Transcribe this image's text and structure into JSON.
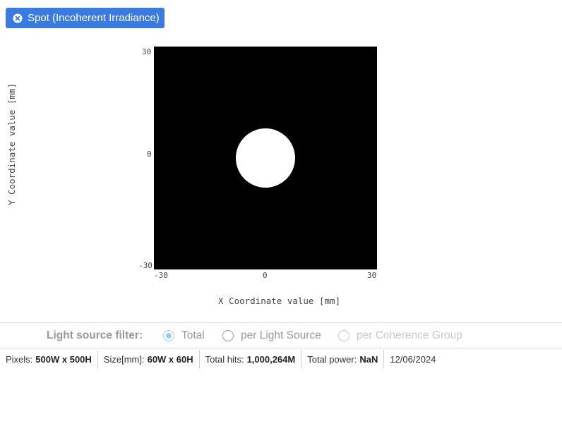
{
  "header": {
    "title": "Spot (Incoherent Irradiance)",
    "icon": "close-circle-icon",
    "accent_color": "#3a7be0"
  },
  "plot": {
    "x_axis_title": "X Coordinate value [mm]",
    "y_axis_title": "Y Coordinate value [mm]",
    "x_ticks": [
      "-30",
      "0",
      "30"
    ],
    "y_ticks": [
      "30",
      "0",
      "-30"
    ],
    "x_range_mm": [
      -30,
      30
    ],
    "y_range_mm": [
      -30,
      30
    ],
    "background_color": "#000000",
    "spot_color": "#ffffff"
  },
  "filter": {
    "label": "Light source filter:",
    "options": [
      {
        "label": "Total",
        "selected": true,
        "disabled": false
      },
      {
        "label": "per Light Source",
        "selected": false,
        "disabled": false
      },
      {
        "label": "per Coherence Group",
        "selected": false,
        "disabled": true
      }
    ]
  },
  "status": {
    "pixels_label": "Pixels:",
    "pixels_value": "500W x 500H",
    "size_label": "Size[mm]:",
    "size_value": "60W x 60H",
    "hits_label": "Total hits:",
    "hits_value": "1,000,264M",
    "power_label": "Total power:",
    "power_value": "NaN",
    "date": "12/06/2024"
  }
}
